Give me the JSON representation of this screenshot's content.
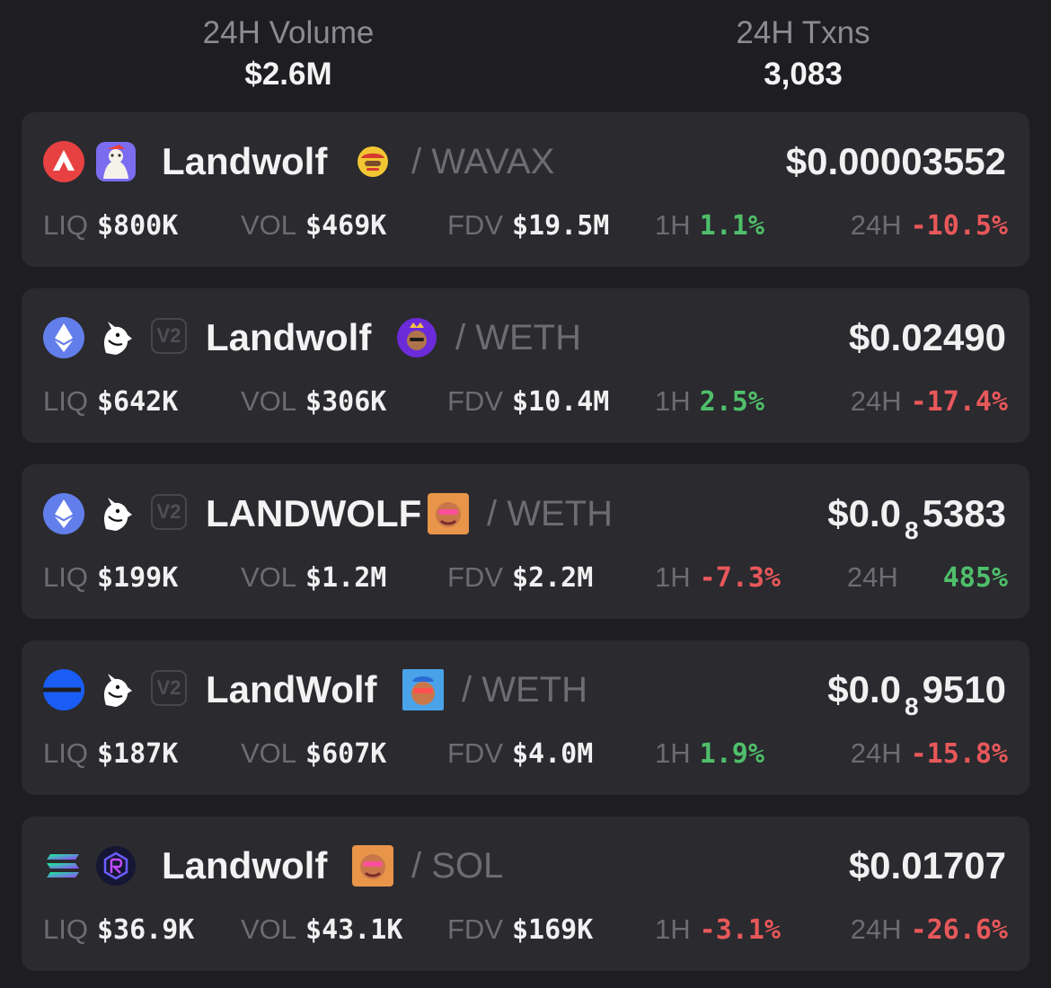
{
  "stats": {
    "volume_label": "24H Volume",
    "volume_value": "$2.6M",
    "txns_label": "24H Txns",
    "txns_value": "3,083"
  },
  "labels": {
    "liq": "LIQ",
    "vol": "VOL",
    "fdv": "FDV",
    "h1": "1H",
    "h24": "24H"
  },
  "colors": {
    "positive": "#4fbf6a",
    "negative": "#e8585a",
    "card": "#2a2a2f",
    "background": "#1e1e22"
  },
  "pairs": [
    {
      "chain_icon": "avalanche-icon",
      "dex_icon": "trader-joe-icon",
      "badge": "",
      "name": "Landwolf",
      "quote": "/ WAVAX",
      "price": "$0.00003552",
      "liq": "$800K",
      "vol": "$469K",
      "fdv": "$19.5M",
      "change_1h": "1.1%",
      "change_24h": "-10.5%"
    },
    {
      "chain_icon": "ethereum-icon",
      "dex_icon": "uniswap-icon",
      "badge": "V2",
      "name": "Landwolf",
      "quote": "/ WETH",
      "price": "$0.02490",
      "liq": "$642K",
      "vol": "$306K",
      "fdv": "$10.4M",
      "change_1h": "2.5%",
      "change_24h": "-17.4%"
    },
    {
      "chain_icon": "ethereum-icon",
      "dex_icon": "uniswap-icon",
      "badge": "V2",
      "name": "LANDWOLF",
      "quote": "/ WETH",
      "price_prefix": "$0.0",
      "price_zeros": "8",
      "price_digits": "5383",
      "liq": "$199K",
      "vol": "$1.2M",
      "fdv": "$2.2M",
      "change_1h": "-7.3%",
      "change_24h": "485%"
    },
    {
      "chain_icon": "base-icon",
      "dex_icon": "uniswap-icon",
      "badge": "V2",
      "name": "LandWolf",
      "quote": "/ WETH",
      "price_prefix": "$0.0",
      "price_zeros": "8",
      "price_digits": "9510",
      "liq": "$187K",
      "vol": "$607K",
      "fdv": "$4.0M",
      "change_1h": "1.9%",
      "change_24h": "-15.8%"
    },
    {
      "chain_icon": "solana-icon",
      "dex_icon": "raydium-icon",
      "badge": "",
      "name": "Landwolf",
      "quote": "/ SOL",
      "price": "$0.01707",
      "liq": "$36.9K",
      "vol": "$43.1K",
      "fdv": "$169K",
      "change_1h": "-3.1%",
      "change_24h": "-26.6%"
    }
  ]
}
